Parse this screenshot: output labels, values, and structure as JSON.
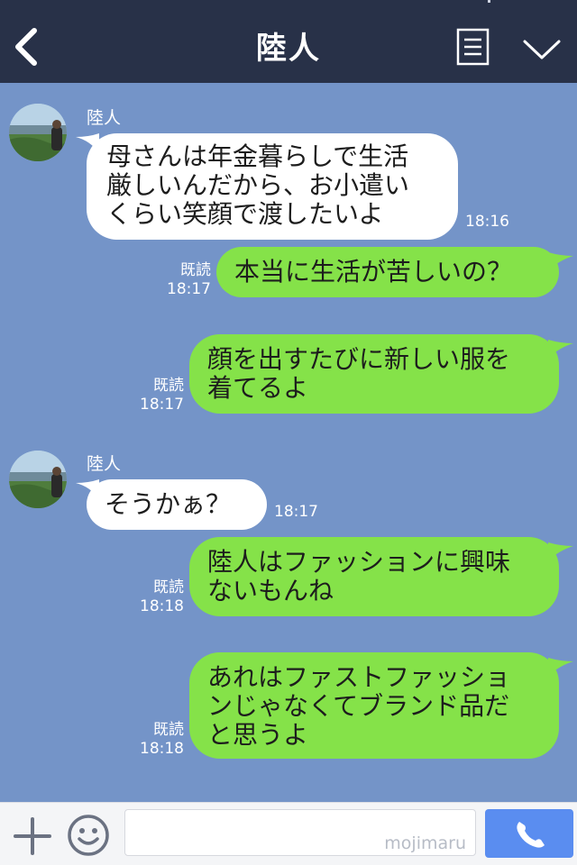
{
  "header": {
    "title": "陸人",
    "back_icon": "chevron-left-icon",
    "notes_icon": "notes-icon",
    "menu_icon": "chevron-down-icon",
    "background": "#283148"
  },
  "chat": {
    "background": "#7494c8",
    "messages": [
      {
        "direction": "in",
        "sender": "陸人",
        "text": "母さんは年金暮らしで生活\n厳しいんだから、お小遣い\nくらい笑顔で渡したいよ",
        "time": "18:16"
      },
      {
        "direction": "out",
        "read": "既読",
        "text": "本当に生活が苦しいの？",
        "time": "18:17"
      },
      {
        "direction": "out",
        "read": "既読",
        "text": "顔を出すたびに新しい服を\n着てるよ",
        "time": "18:17"
      },
      {
        "direction": "in",
        "sender": "陸人",
        "text": "そうかぁ？",
        "time": "18:17"
      },
      {
        "direction": "out",
        "read": "既読",
        "text": "陸人はファッションに興味\nないもんね",
        "time": "18:18"
      },
      {
        "direction": "out",
        "read": "既読",
        "text": "あれはファストファッショ\nンじゃなくてブランド品だ\nと思うよ",
        "time": "18:18"
      }
    ],
    "bubble_colors": {
      "incoming": "#ffffff",
      "outgoing": "#85e249"
    }
  },
  "footer": {
    "plus_icon": "plus-icon",
    "emoji_icon": "smiley-icon",
    "input_value": "",
    "watermark": "mojimaru",
    "call_icon": "phone-icon",
    "call_color": "#5a8df0"
  }
}
